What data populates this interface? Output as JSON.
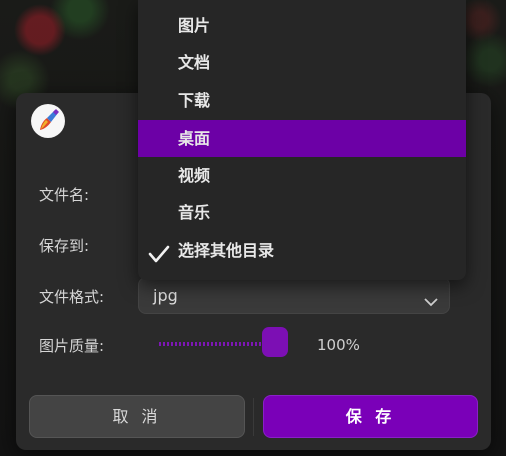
{
  "dialog": {
    "labels": {
      "filename": "文件名:",
      "save_to": "保存到:",
      "format": "文件格式:",
      "quality": "图片质量:"
    },
    "format": {
      "value": "jpg"
    },
    "quality": {
      "value": 100,
      "text": "100%"
    },
    "buttons": {
      "cancel": "取 消",
      "save": "保 存"
    }
  },
  "save_to_menu": {
    "items": [
      {
        "label": "图片",
        "selected": false,
        "checked": false
      },
      {
        "label": "文档",
        "selected": false,
        "checked": false
      },
      {
        "label": "下载",
        "selected": false,
        "checked": false
      },
      {
        "label": "桌面",
        "selected": true,
        "checked": false
      },
      {
        "label": "视频",
        "selected": false,
        "checked": false
      },
      {
        "label": "音乐",
        "selected": false,
        "checked": false
      },
      {
        "label": "选择其他目录",
        "selected": false,
        "checked": true
      }
    ]
  },
  "colors": {
    "accent": "#7a00b8",
    "menu_highlight": "#6c00a6",
    "dialog_bg": "#2a2a2a"
  },
  "icons": {
    "app": "paint-brush-logo-icon",
    "dropdown": "chevron-down-icon",
    "check": "checkmark-icon"
  }
}
